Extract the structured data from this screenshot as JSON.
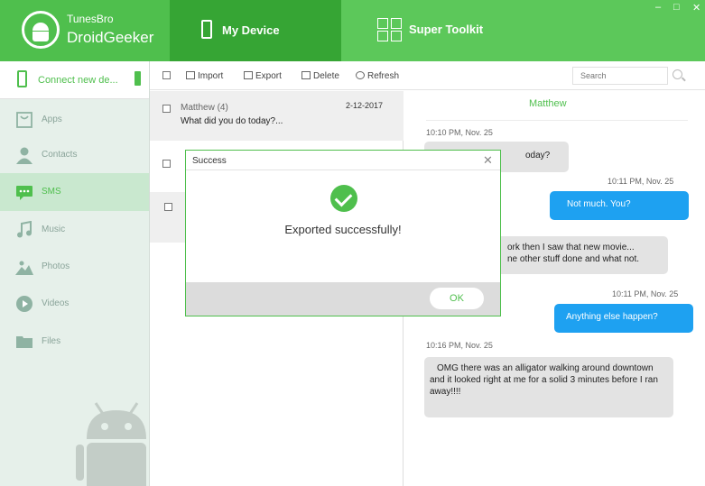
{
  "app": {
    "brand_sub": "TunesBro",
    "brand_name": "DroidGeeker"
  },
  "tabs": {
    "my_device": "My Device",
    "super_toolkit": "Super Toolkit"
  },
  "window_controls": {
    "minimize": "–",
    "restore": "□",
    "close": "✕"
  },
  "sidebar": {
    "connect_label": "Connect new de...",
    "items": [
      {
        "label": "Apps",
        "icon": "bag-icon"
      },
      {
        "label": "Contacts",
        "icon": "person-icon"
      },
      {
        "label": "SMS",
        "icon": "chat-icon"
      },
      {
        "label": "Music",
        "icon": "music-note-icon"
      },
      {
        "label": "Photos",
        "icon": "mountain-photo-icon"
      },
      {
        "label": "Videos",
        "icon": "play-circle-icon"
      },
      {
        "label": "Files",
        "icon": "folder-icon"
      }
    ],
    "active_index": 2
  },
  "toolbar": {
    "import_label": "Import",
    "export_label": "Export",
    "delete_label": "Delete",
    "refresh_label": "Refresh",
    "search_placeholder": "Search"
  },
  "message_list": {
    "rows": [
      {
        "name": "Matthew (4)",
        "date": "2-12-2017",
        "preview": "What did you do today?..."
      }
    ]
  },
  "conversation": {
    "title": "Matthew",
    "messages": [
      {
        "direction": "in",
        "timestamp": "10:10 PM, Nov. 25",
        "text": "oday?"
      },
      {
        "direction": "out",
        "timestamp": "10:11 PM, Nov. 25",
        "text": "Not much. You?"
      },
      {
        "direction": "in",
        "timestamp": "",
        "text": "ork then I saw that new movie...\nne other stuff done and  what not."
      },
      {
        "direction": "out",
        "timestamp": "10:11 PM, Nov. 25",
        "text": "Anything else happen?"
      },
      {
        "direction": "in",
        "timestamp": "10:16 PM, Nov. 25",
        "text": "OMG there was an alligator walking around downtown and it looked right at me for a solid 3 minutes before I ran away!!!!"
      }
    ]
  },
  "modal": {
    "title": "Success",
    "close": "✕",
    "message": "Exported successfully!",
    "ok_label": "OK"
  },
  "colors": {
    "brand_green": "#5cc85a",
    "active_tab_green": "#36a534",
    "sms_blue": "#1ea1f1",
    "sidebar_bg": "#e6f0ea"
  }
}
